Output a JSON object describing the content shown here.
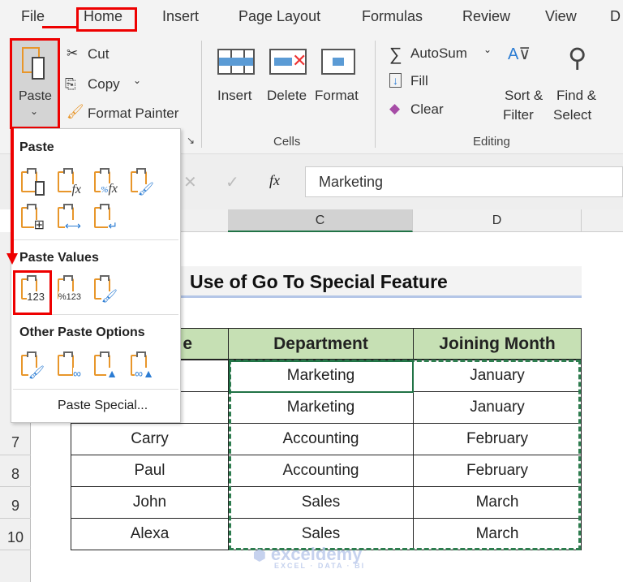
{
  "tabs": [
    "File",
    "Home",
    "Insert",
    "Page Layout",
    "Formulas",
    "Review",
    "View",
    "D"
  ],
  "clipboard": {
    "paste": "Paste",
    "cut": "Cut",
    "copy": "Copy",
    "format_painter": "Format Painter"
  },
  "cells_group": {
    "insert": "Insert",
    "delete": "Delete",
    "format": "Format",
    "label": "Cells"
  },
  "editing_group": {
    "autosum": "AutoSum",
    "fill": "Fill",
    "clear": "Clear",
    "sort1": "Sort &",
    "sort2": "Filter",
    "find1": "Find &",
    "find2": "Select",
    "label": "Editing"
  },
  "formula_bar": {
    "fx": "fx",
    "value": "Marketing"
  },
  "columns": [
    "C",
    "D"
  ],
  "rows": [
    "7",
    "8",
    "9",
    "10"
  ],
  "sheet": {
    "title": "Use of Go To Special Feature",
    "headers": [
      "e",
      "Department",
      "Joining Month"
    ],
    "data": [
      [
        "",
        "Marketing",
        "January"
      ],
      [
        "",
        "Marketing",
        "January"
      ],
      [
        "Carry",
        "Accounting",
        "February"
      ],
      [
        "Paul",
        "Accounting",
        "February"
      ],
      [
        "John",
        "Sales",
        "March"
      ],
      [
        "Alexa",
        "Sales",
        "March"
      ]
    ]
  },
  "paste_menu": {
    "paste": "Paste",
    "paste_values": "Paste Values",
    "other": "Other Paste Options",
    "special": "Paste Special...",
    "values_icons": [
      "123",
      "%123",
      "123 brush"
    ]
  },
  "watermark": {
    "name": "exceldemy",
    "tag": "EXCEL · DATA · BI"
  },
  "colors": {
    "highlight": "#e00000",
    "header_fill": "#c6e0b4",
    "selection": "#217346"
  }
}
